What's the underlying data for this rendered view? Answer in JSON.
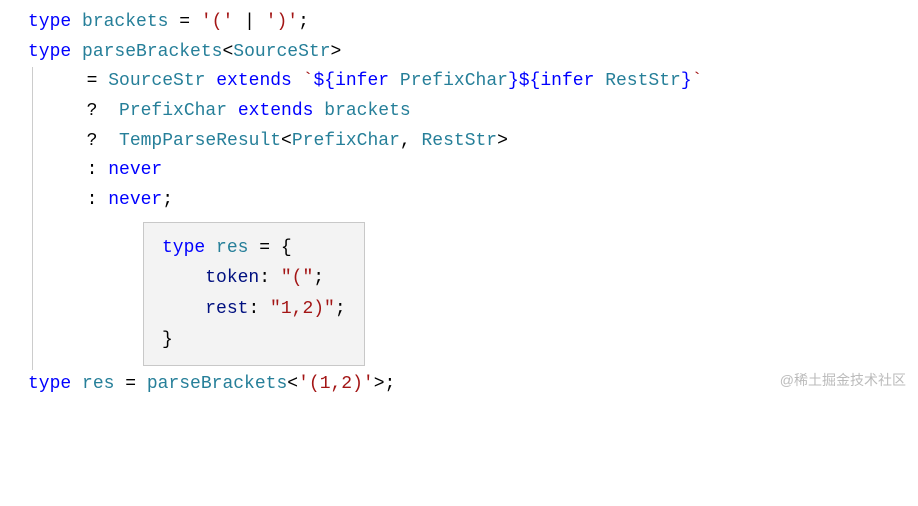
{
  "line1": {
    "type_kw": "type",
    "name": "brackets",
    "eq": " = ",
    "val1": "'('",
    "bar": " | ",
    "val2": "')'",
    "semi": ";"
  },
  "line2": {
    "type_kw": "type",
    "name": "parseBrackets",
    "lt": "<",
    "generic": "SourceStr",
    "gt": ">"
  },
  "line3": {
    "eq": "= ",
    "sourcestr": "SourceStr",
    "extends": " extends ",
    "backtick1": "`",
    "dollar1": "${",
    "infer1": "infer",
    "sp1": " ",
    "prefixchar": "PrefixChar",
    "close1": "}",
    "dollar2": "${",
    "infer2": "infer",
    "sp2": " ",
    "reststr": "RestStr",
    "close2": "}",
    "backtick2": "`"
  },
  "line4": {
    "q": "?  ",
    "prefixchar": "PrefixChar",
    "extends": " extends ",
    "brackets": "brackets"
  },
  "line5": {
    "q": "?  ",
    "tempparse": "TempParseResult",
    "lt": "<",
    "prefixchar": "PrefixChar",
    "comma": ", ",
    "reststr": "RestStr",
    "gt": ">"
  },
  "line6": {
    "colon": ": ",
    "never": "never"
  },
  "line7": {
    "colon": ": ",
    "never": "never",
    "semi": ";"
  },
  "tooltip": {
    "type_kw": "type",
    "name": "res",
    "eq": " = {",
    "token_key": "token",
    "token_colon": ": ",
    "token_val": "\"(\"",
    "token_semi": ";",
    "rest_key": "rest",
    "rest_colon": ": ",
    "rest_val": "\"1,2)\"",
    "rest_semi": ";",
    "close": "}"
  },
  "line_last": {
    "type_kw": "type",
    "name": "res",
    "eq": " = ",
    "parsebrackets": "parseBrackets",
    "lt": "<",
    "arg": "'(1,2)'",
    "gt": ">",
    "semi": ";"
  },
  "watermark": "@稀土掘金技术社区"
}
